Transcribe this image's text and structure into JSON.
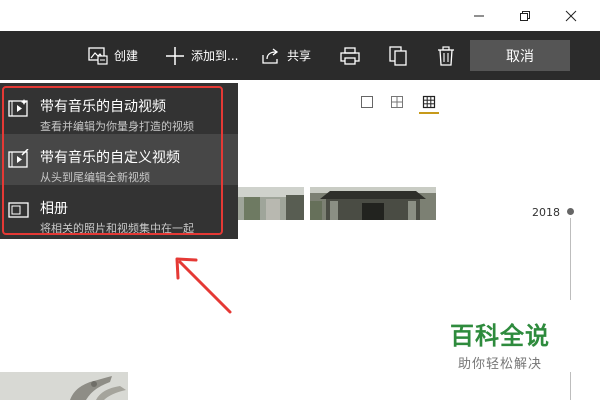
{
  "window": {
    "minimize_icon": "minimize-icon",
    "restore_icon": "restore-icon",
    "close_icon": "close-icon"
  },
  "toolbar": {
    "create_label": "创建",
    "add_to_label": "添加到...",
    "share_label": "共享",
    "cancel_label": "取消",
    "background": "#2b2b2b"
  },
  "menu": {
    "items": [
      {
        "title": "带有音乐的自动视频",
        "subtitle": "查看并编辑为你量身打造的视频",
        "icon": "auto-video-icon"
      },
      {
        "title": "带有音乐的自定义视频",
        "subtitle": "从头到尾编辑全新视频",
        "icon": "custom-video-icon"
      },
      {
        "title": "相册",
        "subtitle": "将相关的照片和视频集中在一起",
        "icon": "album-icon"
      }
    ],
    "highlight_color": "#e53935"
  },
  "timeline": {
    "year": "2018"
  },
  "watermark": {
    "title": "百科全说",
    "subtitle": "助你轻松解决"
  }
}
